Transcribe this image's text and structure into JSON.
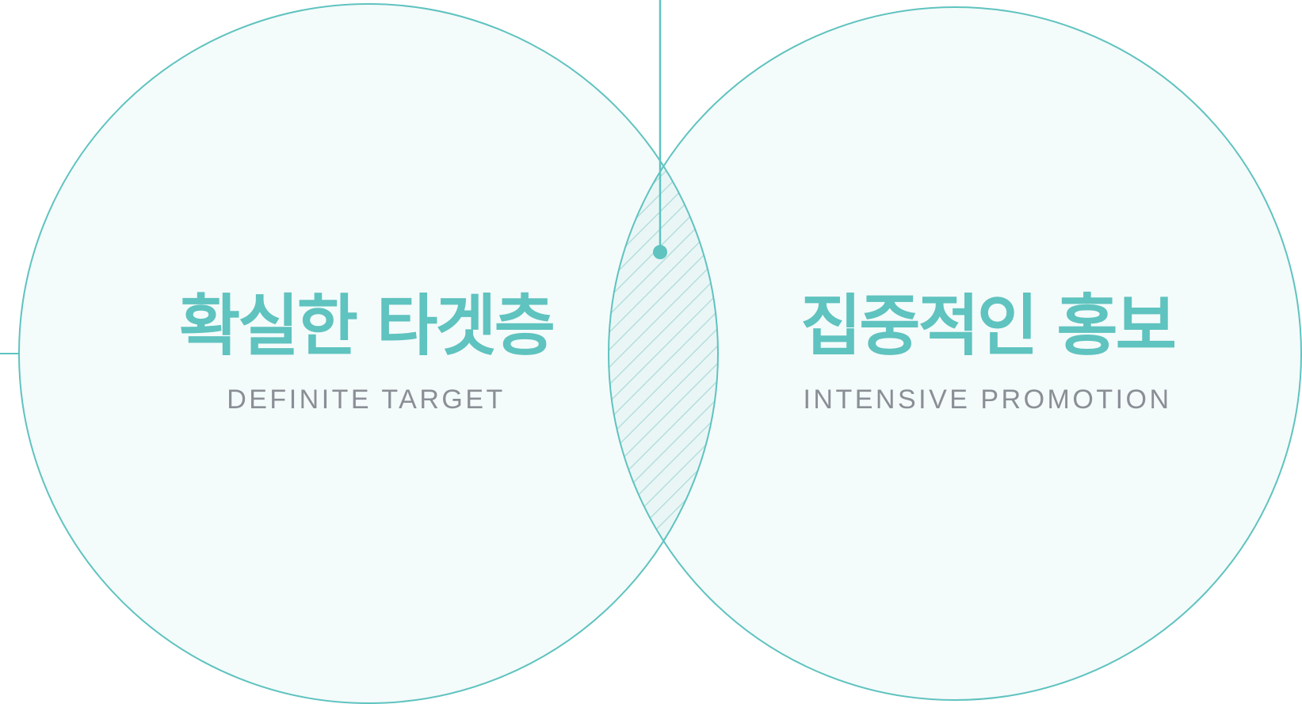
{
  "colors": {
    "accent": "#5fc3bf",
    "circle_fill": "#f4fbfb",
    "overlap_fill": "#eaf6f6",
    "hatch": "#b7e0de",
    "subtitle": "#8a8f96"
  },
  "left_circle": {
    "title": "확실한 타겟층",
    "subtitle": "DEFINITE TARGET"
  },
  "right_circle": {
    "title": "집중적인 홍보",
    "subtitle": "INTENSIVE PROMOTION"
  }
}
